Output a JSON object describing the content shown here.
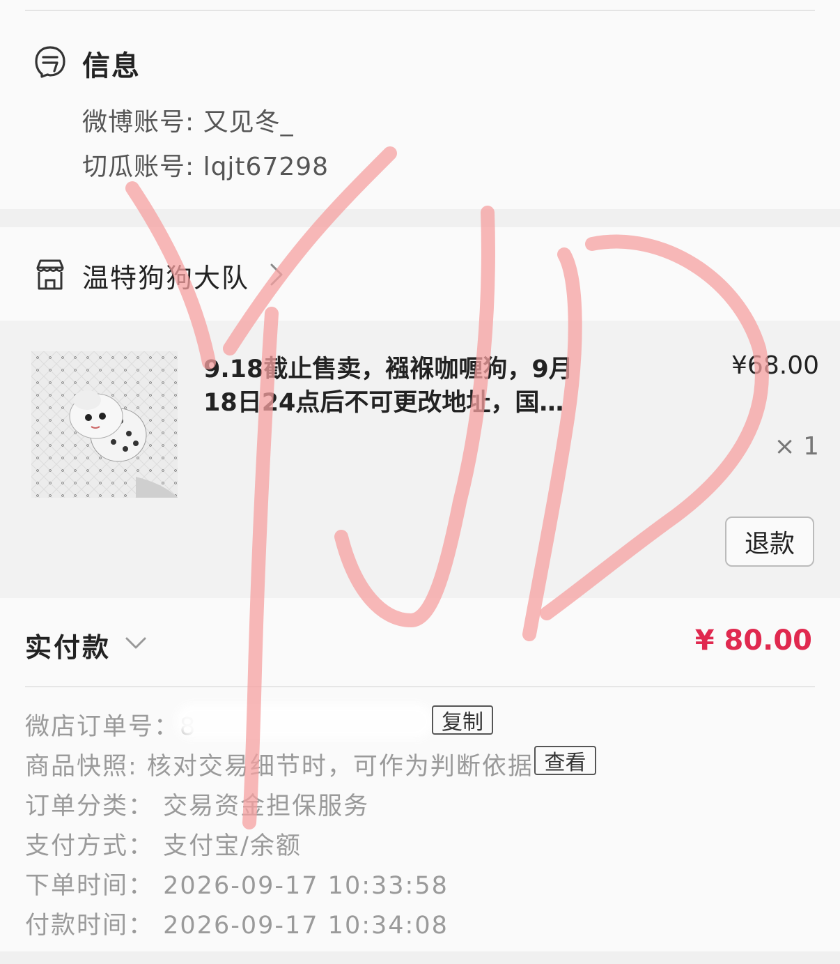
{
  "info": {
    "title": "信息",
    "weibo_line": "微博账号: 又见冬_",
    "qiegua_line": "切瓜账号: lqjt67298"
  },
  "shop": {
    "name": "温特狗狗大队"
  },
  "product": {
    "title": "9.18截止售卖，襁褓咖喱狗，9月18日24点后不可更改地址，国…",
    "price": "¥68.00",
    "quantity": "× 1",
    "refund_label": "退款"
  },
  "payment": {
    "label": "实付款",
    "amount": "¥ 80.00",
    "amount_color": "#e0294f"
  },
  "details": {
    "order_no_label": "微店订单号：",
    "order_no_value": "8",
    "copy_label": "复制",
    "snapshot_label": "商品快照:",
    "snapshot_value": " 核对交易细节时，可作为判断依据",
    "view_label": "查看",
    "category_label": "订单分类：",
    "category_value": " 交易资金担保服务",
    "pay_method_label": "支付方式：",
    "pay_method_value": " 支付宝/余额",
    "order_time_label": "下单时间：",
    "order_time_value": " 2026-09-17 10:33:58",
    "pay_time_label": "付款时间：",
    "pay_time_value": " 2026-09-17 10:34:08"
  },
  "watermark": {
    "color": "#f5a0a0"
  }
}
